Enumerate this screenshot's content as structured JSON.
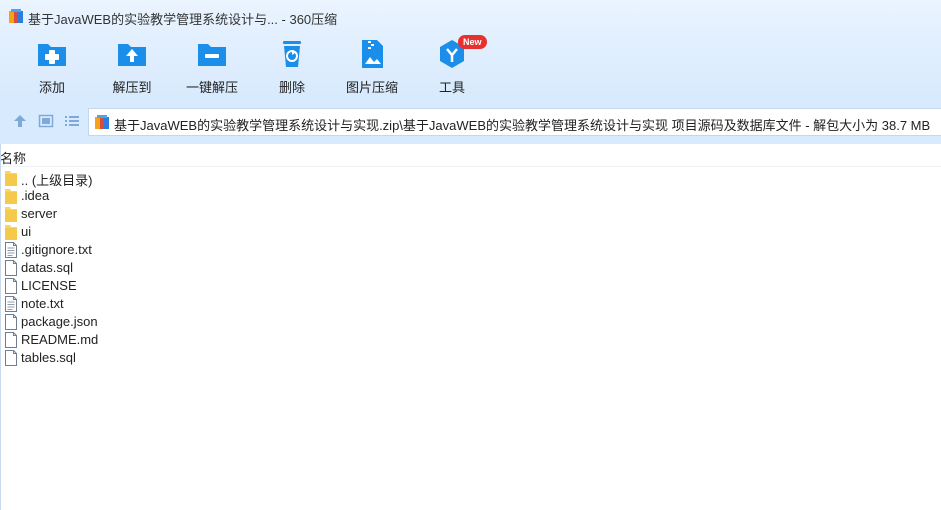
{
  "window": {
    "title": "基于JavaWEB的实验教学管理系统设计与... - 360压缩"
  },
  "toolbar": {
    "items": [
      {
        "label": "添加",
        "icon": "add-folder-icon"
      },
      {
        "label": "解压到",
        "icon": "extract-to-icon"
      },
      {
        "label": "一键解压",
        "icon": "one-click-extract-icon"
      },
      {
        "label": "删除",
        "icon": "delete-bin-icon"
      },
      {
        "label": "图片压缩",
        "icon": "image-compress-icon"
      },
      {
        "label": "工具",
        "icon": "tools-icon",
        "badge": "New"
      }
    ]
  },
  "address": {
    "path": "基于JavaWEB的实验教学管理系统设计与实现.zip\\基于JavaWEB的实验教学管理系统设计与实现 项目源码及数据库文件 - 解包大小为 38.7 MB"
  },
  "list": {
    "column_name": "名称",
    "files": [
      {
        "name": ".. (上级目录)",
        "type": "folder"
      },
      {
        "name": ".idea",
        "type": "folder"
      },
      {
        "name": "server",
        "type": "folder"
      },
      {
        "name": "ui",
        "type": "folder"
      },
      {
        "name": ".gitignore.txt",
        "type": "text"
      },
      {
        "name": "datas.sql",
        "type": "file"
      },
      {
        "name": "LICENSE",
        "type": "file"
      },
      {
        "name": "note.txt",
        "type": "text"
      },
      {
        "name": "package.json",
        "type": "file"
      },
      {
        "name": "README.md",
        "type": "file"
      },
      {
        "name": "tables.sql",
        "type": "file"
      }
    ]
  },
  "colors": {
    "accent": "#1a8ee8",
    "toolbar_bg": "#d8eafd",
    "badge": "#e8302f",
    "folder": "#f8d46a"
  }
}
